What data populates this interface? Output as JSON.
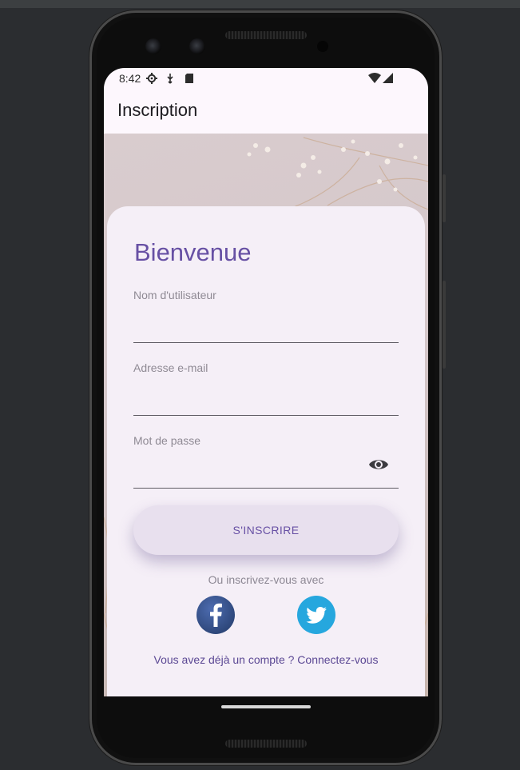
{
  "status_bar": {
    "time": "8:42",
    "left_icons": [
      "settings-icon",
      "usb-icon",
      "sd-card-icon"
    ],
    "right_icons": [
      "wifi-icon",
      "signal-icon"
    ]
  },
  "app_bar": {
    "title": "Inscription"
  },
  "form": {
    "heading": "Bienvenue",
    "username": {
      "label": "Nom d'utilisateur",
      "value": ""
    },
    "email": {
      "label": "Adresse e-mail",
      "value": ""
    },
    "password": {
      "label": "Mot de passe",
      "value": "",
      "toggle_icon": "eye-icon"
    },
    "submit_label": "S'INSCRIRE",
    "alt_text": "Ou inscrivez-vous avec",
    "social": [
      {
        "name": "facebook",
        "icon": "facebook-icon",
        "color": "#3b5998"
      },
      {
        "name": "twitter",
        "icon": "twitter-icon",
        "color": "#26a7de"
      }
    ],
    "login_prompt": "Vous avez déjà un compte ? Connectez-vous"
  },
  "colors": {
    "primary": "#6750a4",
    "card": "#f5eff7",
    "button": "#e8e0ee"
  }
}
